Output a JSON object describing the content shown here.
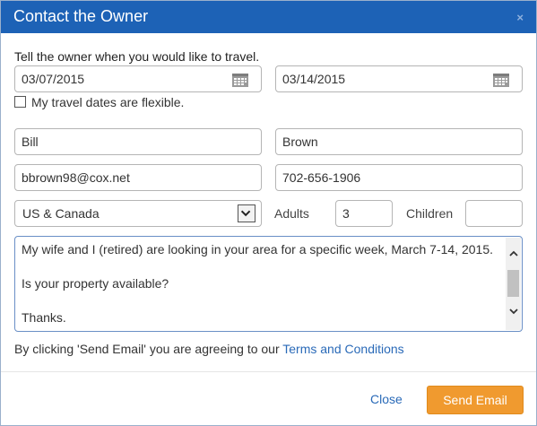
{
  "dialog": {
    "title": "Contact the Owner",
    "close_icon": "×"
  },
  "form": {
    "prompt": "Tell the owner when you would like to travel.",
    "arrival_date": "03/07/2015",
    "departure_date": "03/14/2015",
    "flexible_label": "My travel dates are flexible.",
    "flexible_checked": false,
    "first_name": "Bill",
    "last_name": "Brown",
    "email": "bbrown98@cox.net",
    "phone": "702-656-1906",
    "country": "US & Canada",
    "adults_label": "Adults",
    "adults": "3",
    "children_label": "Children",
    "children": "",
    "message": "My wife and I (retired) are looking in your area for a specific week, March 7-14, 2015.\n\nIs your property available?\n\nThanks."
  },
  "terms": {
    "text": "By clicking 'Send Email' you are agreeing to our",
    "link": "Terms and Conditions"
  },
  "footer": {
    "close_label": "Close",
    "send_label": "Send Email"
  },
  "colors": {
    "titlebar": "#1d62b6",
    "link": "#2a6ab8",
    "send_button": "#f09a2f"
  },
  "icons": {
    "calendar": "calendar-icon",
    "dropdown": "chevron-down-icon",
    "scroll_up": "chevron-up-icon",
    "scroll_down": "chevron-down-icon"
  }
}
